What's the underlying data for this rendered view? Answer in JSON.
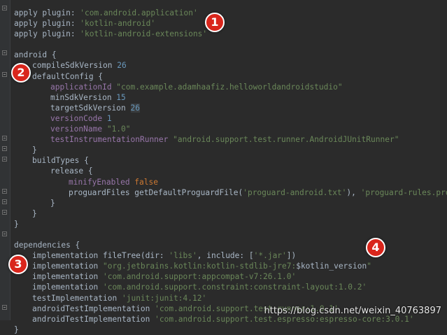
{
  "code_lines": [
    {
      "tokens": [
        {
          "t": "apply plugin: ",
          "c": "plain"
        },
        {
          "t": "'com.android.application'",
          "c": "str"
        }
      ]
    },
    {
      "tokens": [
        {
          "t": "apply plugin: ",
          "c": "plain"
        },
        {
          "t": "'kotlin-android'",
          "c": "str"
        }
      ]
    },
    {
      "tokens": [
        {
          "t": "apply plugin: ",
          "c": "plain"
        },
        {
          "t": "'kotlin-android-extensions'",
          "c": "str"
        }
      ]
    },
    {
      "tokens": []
    },
    {
      "tokens": [
        {
          "t": "android {",
          "c": "plain"
        }
      ]
    },
    {
      "indent": 1,
      "tokens": [
        {
          "t": "compileSdkVersion ",
          "c": "plain"
        },
        {
          "t": "26",
          "c": "num"
        }
      ]
    },
    {
      "indent": 1,
      "tokens": [
        {
          "t": "defaultConfig {",
          "c": "plain"
        }
      ]
    },
    {
      "indent": 2,
      "tokens": [
        {
          "t": "applicationId ",
          "c": "prop"
        },
        {
          "t": "\"com.example.adamhaafiz.helloworldandroidstudio\"",
          "c": "str"
        }
      ]
    },
    {
      "indent": 2,
      "tokens": [
        {
          "t": "minSdkVersion ",
          "c": "plain"
        },
        {
          "t": "15",
          "c": "num"
        }
      ]
    },
    {
      "indent": 2,
      "tokens": [
        {
          "t": "targetSdkVersion ",
          "c": "plain"
        },
        {
          "t": "26",
          "c": "num",
          "hl": true
        }
      ]
    },
    {
      "indent": 2,
      "tokens": [
        {
          "t": "versionCode ",
          "c": "prop"
        },
        {
          "t": "1",
          "c": "num"
        }
      ]
    },
    {
      "indent": 2,
      "tokens": [
        {
          "t": "versionName ",
          "c": "prop"
        },
        {
          "t": "\"1.0\"",
          "c": "str"
        }
      ]
    },
    {
      "indent": 2,
      "tokens": [
        {
          "t": "testInstrumentationRunner ",
          "c": "prop"
        },
        {
          "t": "\"android.support.test.runner.AndroidJUnitRunner\"",
          "c": "str"
        }
      ]
    },
    {
      "indent": 1,
      "tokens": [
        {
          "t": "}",
          "c": "plain"
        }
      ]
    },
    {
      "indent": 1,
      "tokens": [
        {
          "t": "buildTypes {",
          "c": "plain"
        }
      ]
    },
    {
      "indent": 2,
      "tokens": [
        {
          "t": "release {",
          "c": "plain"
        }
      ]
    },
    {
      "indent": 3,
      "tokens": [
        {
          "t": "minifyEnabled ",
          "c": "prop"
        },
        {
          "t": "false",
          "c": "kw"
        }
      ]
    },
    {
      "indent": 3,
      "tokens": [
        {
          "t": "proguardFiles getDefaultProguardFile(",
          "c": "plain"
        },
        {
          "t": "'proguard-android.txt'",
          "c": "str"
        },
        {
          "t": "), ",
          "c": "plain"
        },
        {
          "t": "'proguard-rules.pro'",
          "c": "str"
        }
      ]
    },
    {
      "indent": 2,
      "tokens": [
        {
          "t": "}",
          "c": "plain"
        }
      ]
    },
    {
      "indent": 1,
      "tokens": [
        {
          "t": "}",
          "c": "plain"
        }
      ]
    },
    {
      "tokens": [
        {
          "t": "}",
          "c": "plain"
        }
      ]
    },
    {
      "tokens": []
    },
    {
      "tokens": [
        {
          "t": "dependencies {",
          "c": "plain"
        }
      ]
    },
    {
      "indent": 1,
      "tokens": [
        {
          "t": "implementation fileTree(",
          "c": "plain"
        },
        {
          "t": "dir: ",
          "c": "plain"
        },
        {
          "t": "'libs'",
          "c": "str"
        },
        {
          "t": ", ",
          "c": "plain"
        },
        {
          "t": "include: ",
          "c": "plain"
        },
        {
          "t": "[",
          "c": "plain"
        },
        {
          "t": "'*.jar'",
          "c": "str"
        },
        {
          "t": "])",
          "c": "plain"
        }
      ]
    },
    {
      "indent": 1,
      "tokens": [
        {
          "t": "implementation ",
          "c": "plain"
        },
        {
          "t": "\"org.jetbrains.kotlin:kotlin-stdlib-jre7:",
          "c": "str"
        },
        {
          "t": "$kotlin_version",
          "c": "plain"
        },
        {
          "t": "\"",
          "c": "str"
        }
      ]
    },
    {
      "indent": 1,
      "tokens": [
        {
          "t": "implementation ",
          "c": "plain"
        },
        {
          "t": "'com.android.support:appcompat-v7:26.1.0'",
          "c": "str"
        }
      ]
    },
    {
      "indent": 1,
      "tokens": [
        {
          "t": "implementation ",
          "c": "plain"
        },
        {
          "t": "'com.android.support.constraint:constraint-layout:1.0.2'",
          "c": "str"
        }
      ]
    },
    {
      "indent": 1,
      "tokens": [
        {
          "t": "testImplementation ",
          "c": "plain"
        },
        {
          "t": "'junit:junit:4.12'",
          "c": "str"
        }
      ]
    },
    {
      "indent": 1,
      "tokens": [
        {
          "t": "androidTestImplementation ",
          "c": "plain"
        },
        {
          "t": "'com.android.support.test:runner:1.0.1'",
          "c": "str"
        }
      ]
    },
    {
      "indent": 1,
      "tokens": [
        {
          "t": "androidTestImplementation ",
          "c": "plain"
        },
        {
          "t": "'com.android.support.test.espresso:espresso-core:3.0.1'",
          "c": "str"
        }
      ]
    },
    {
      "tokens": [
        {
          "t": "}",
          "c": "plain"
        }
      ]
    }
  ],
  "callouts": [
    "1",
    "2",
    "3",
    "4"
  ],
  "watermark": "https://blog.csdn.net/weixin_40763897",
  "colors": {
    "background": "#2b2b2b",
    "string": "#6a8759",
    "number": "#6897bb",
    "property": "#9876aa",
    "keyword": "#cc7832",
    "callout": "#d9261c"
  }
}
